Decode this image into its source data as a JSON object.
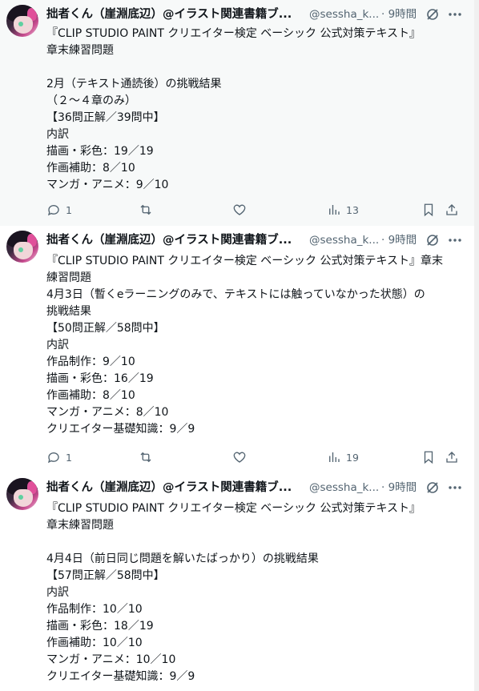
{
  "tweets": [
    {
      "author_name": "拙者くん（崖淵底辺）@イラスト関連書籍ブ...",
      "handle": "@sessha_k...",
      "time": "9時間",
      "lines": [
        "『CLIP STUDIO PAINT クリエイター検定 ベーシック 公式対策テキスト』",
        "章末練習問題",
        "",
        "2月（テキスト通読後）の挑戦結果",
        "（２～４章のみ）",
        "【36問正解／39問中】",
        "内訳",
        "描画・彩色：19／19",
        "作画補助：8／10",
        "マンガ・アニメ：9／10"
      ],
      "replies": "1",
      "retweets": "",
      "likes": "",
      "views": "13"
    },
    {
      "author_name": "拙者くん（崖淵底辺）@イラスト関連書籍ブ...",
      "handle": "@sessha_k...",
      "time": "9時間",
      "lines": [
        "『CLIP STUDIO PAINT クリエイター検定 ベーシック 公式対策テキスト』章末",
        "練習問題",
        "4月3日（暫くeラーニングのみで、テキストには触っていなかった状態）の",
        "挑戦結果",
        "【50問正解／58問中】",
        "内訳",
        "作品制作：9／10",
        "描画・彩色：16／19",
        "作画補助：8／10",
        "マンガ・アニメ：8／10",
        "クリエイター基礎知識：9／9"
      ],
      "replies": "1",
      "retweets": "",
      "likes": "",
      "views": "19"
    },
    {
      "author_name": "拙者くん（崖淵底辺）@イラスト関連書籍ブ...",
      "handle": "@sessha_k...",
      "time": "9時間",
      "lines": [
        "『CLIP STUDIO PAINT クリエイター検定 ベーシック 公式対策テキスト』",
        "章末練習問題",
        "",
        "4月4日（前日同じ問題を解いたばっかり）の挑戦結果",
        "【57問正解／58問中】",
        "内訳",
        "作品制作：10／10",
        "描画・彩色：18／19",
        "作画補助：10／10",
        "マンガ・アニメ：10／10",
        "クリエイター基礎知識：9／9"
      ]
    }
  ],
  "colors": {
    "text": "#0f1419",
    "muted": "#536471",
    "hover_bg": "#f7f9f9"
  },
  "icons": [
    "reply-icon",
    "retweet-icon",
    "like-icon",
    "views-icon",
    "bookmark-icon",
    "share-icon",
    "grok-icon",
    "more-icon"
  ]
}
